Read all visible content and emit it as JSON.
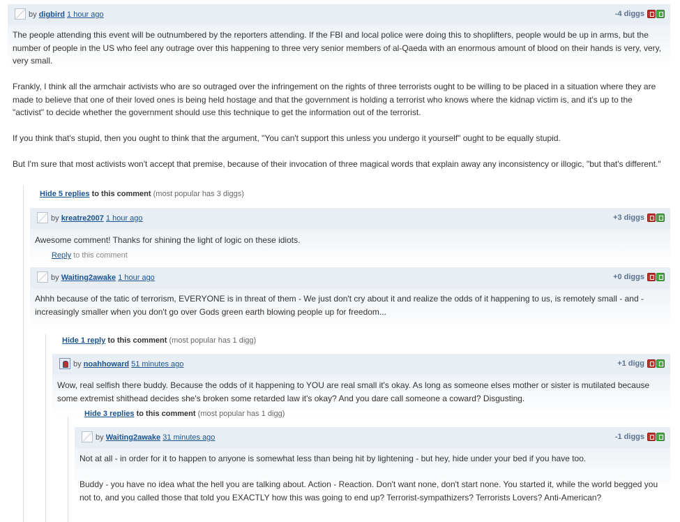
{
  "comments": [
    {
      "by": "by",
      "user": "digbird",
      "time": "1 hour ago",
      "diggs": "-4 diggs",
      "paragraphs": [
        "The people attending this event will be outnumbered by the reporters attending. If the FBI and local police were doing this to shoplifters, people would be up in arms, but the number of people in the US who feel any outrage over this happening to three very senior members of al-Qaeda with an enormous amount of blood on their hands is very, very, very small.",
        "Frankly, I think all the armchair activists who are so outraged over the infringement on the rights of three terrorists ought to be willing to be placed in a situation where they are made to believe that one of their loved ones is being held hostage and that the government is holding a terrorist who knows where the kidnap victim is, and it's up to the \"activist\" to decide whether the government should use this technique to get the information out of the terrorist.",
        "If you think that's stupid, then you ought to think that the argument, \"You can't support this unless you undergo it yourself\" ought to be equally stupid.",
        "But I'm sure that most activists won't accept that premise, because of their invocation of three magical words that explain away any inconsistency or illogic, \"but that's different.\""
      ],
      "replies_link": "Hide 5 replies",
      "replies_rest": "to this comment",
      "replies_note": "(most popular has 3 diggs)"
    },
    {
      "by": "by",
      "user": "kreatre2007",
      "time": "1 hour ago",
      "diggs": "+3 diggs",
      "paragraphs": [
        "Awesome comment! Thanks for shining the light of logic on these idiots."
      ],
      "reply_link": "Reply",
      "reply_rest": "to this comment"
    },
    {
      "by": "by",
      "user": "Waiting2awake",
      "time": "1 hour ago",
      "diggs": "+0 diggs",
      "paragraphs": [
        "Ahhh because of the tatic of terrorism, EVERYONE is in threat of them - We just don't cry about it and realize the odds of it happening to us, is remotely small - and - increasingly smaller when you don't go over Gods green earth blowing people up for freedom..."
      ],
      "replies_link": "Hide 1 reply",
      "replies_rest": "to this comment",
      "replies_note": "(most popular has 1 digg)"
    },
    {
      "by": "by",
      "user": "noahhoward",
      "time": "51 minutes ago",
      "diggs": "+1 digg",
      "paragraphs": [
        "Wow, real selfish there buddy. Because the odds of it happening to YOU are real small it's okay. As long as someone elses mother or sister is mutilated because some extremist shithead decides she's broken some retarded law it's okay? And you dare call someone a coward? Disgusting."
      ],
      "replies_link": "Hide 3 replies",
      "replies_rest": "to this comment",
      "replies_note": "(most popular has 1 digg)"
    },
    {
      "by": "by",
      "user": "Waiting2awake",
      "time": "31 minutes ago",
      "diggs": "-1 diggs",
      "paragraphs": [
        "Not at all - in order for it to happen to anyone is somewhat less than being hit by lightening - but hey, hide under your bed if you have too.",
        "Buddy - you have no idea what the hell you are talking about. Action - Reaction. Don't want none, don't start none. You started it, while the world begged you not to, and you called those that told you EXACTLY how this was going to end up? Terrorist-sympathizers? Terrorists Lovers? Anti-American?"
      ]
    }
  ],
  "icons": {
    "bury": "bury-icon",
    "digg": "digg-up-icon",
    "avatar_default": "default-avatar-icon",
    "avatar_user": "user-avatar-icon"
  },
  "colors": {
    "link": "#1a5490",
    "header_bg": "#e8eef4",
    "bury": "#c0322b",
    "digg": "#4ea84a"
  }
}
